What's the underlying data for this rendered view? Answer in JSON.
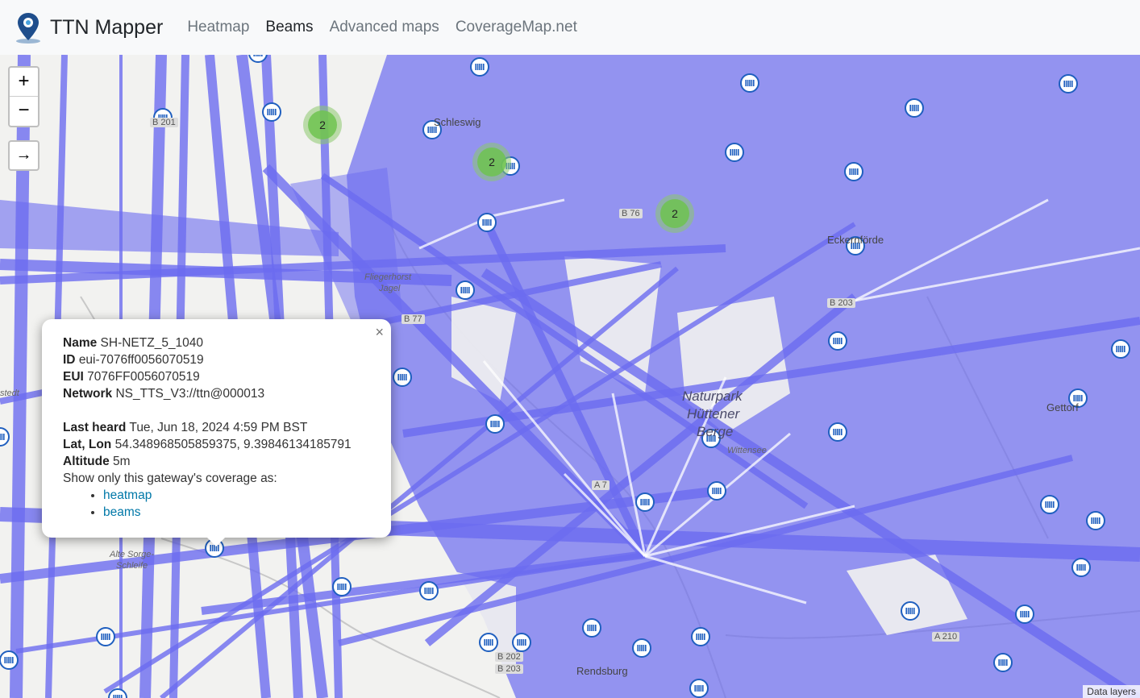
{
  "navbar": {
    "brand": "TTN Mapper",
    "links": [
      {
        "label": "Heatmap",
        "active": false
      },
      {
        "label": "Beams",
        "active": true
      },
      {
        "label": "Advanced maps",
        "active": false
      },
      {
        "label": "CoverageMap.net",
        "active": false
      }
    ]
  },
  "map_controls": {
    "zoom_in": "+",
    "zoom_out": "−",
    "locate": "→"
  },
  "popup": {
    "close": "×",
    "name_label": "Name",
    "name_value": "SH-NETZ_5_1040",
    "id_label": "ID",
    "id_value": "eui-7076ff0056070519",
    "eui_label": "EUI",
    "eui_value": "7076FF0056070519",
    "network_label": "Network",
    "network_value": "NS_TTS_V3://ttn@000013",
    "last_heard_label": "Last heard",
    "last_heard_value": "Tue, Jun 18, 2024 4:59 PM BST",
    "latlon_label": "Lat, Lon",
    "latlon_value": "54.348968505859375, 9.39846134185791",
    "altitude_label": "Altitude",
    "altitude_value": "5m",
    "show_only_text": "Show only this gateway's coverage as:",
    "link_heatmap": "heatmap",
    "link_beams": "beams"
  },
  "map_labels": {
    "schleswig": "Schleswig",
    "eckernforde": "Eckernförde",
    "fliegerhorst": "Fliegerhorst",
    "jagel": "Jagel",
    "naturpark_1": "Naturpark",
    "naturpark_2": "Hüttener",
    "naturpark_3": "Berge",
    "wittensee": "Wittensee",
    "alte_sorge": "Alte Sorge-",
    "schleife": "Schleife",
    "rendsburg": "Rendsburg",
    "gettorf": "Gettorf",
    "stedt": "stedt"
  },
  "roads": {
    "b76": "B 76",
    "b77": "B 77",
    "b203": "B 203",
    "b202": "B 202",
    "b203b": "B 203",
    "a7": "A 7",
    "a210": "A 210",
    "b201": "B 201"
  },
  "clusters": [
    {
      "count": "2"
    },
    {
      "count": "2"
    },
    {
      "count": "2"
    }
  ],
  "attribution": "Data layers",
  "colors": {
    "beam": "#6b6bf0",
    "cluster": "#6ec350",
    "gateway": "#1f5fbf",
    "link": "#0078a8"
  }
}
